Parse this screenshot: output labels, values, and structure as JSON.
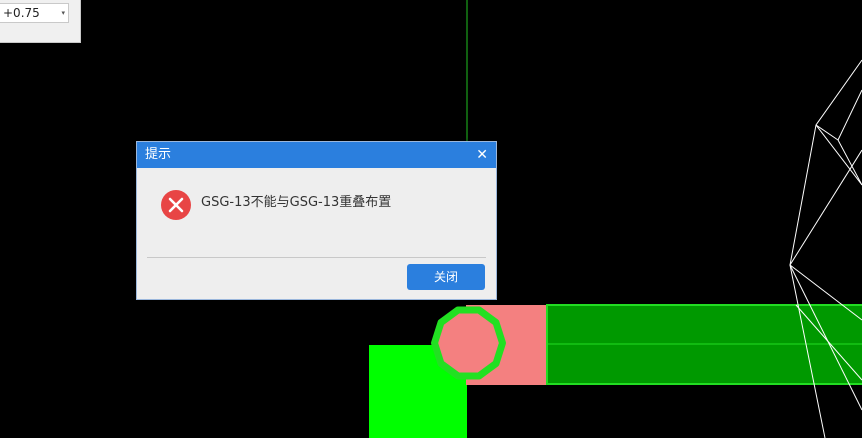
{
  "toolbar": {
    "elevation_value": "+0.75",
    "caret_glyph": "▾"
  },
  "dialog": {
    "title": "提示",
    "close_glyph": "✕",
    "icon": "error-icon",
    "message": "GSG-13不能与GSG-13重叠布置",
    "button_label": "关闭"
  },
  "colors": {
    "canvas": "#000000",
    "bright_green": "#00ff00",
    "dark_green": "#009900",
    "pink": "#f48080",
    "dialog_accent": "#2b7fde",
    "error_red": "#e84545"
  }
}
